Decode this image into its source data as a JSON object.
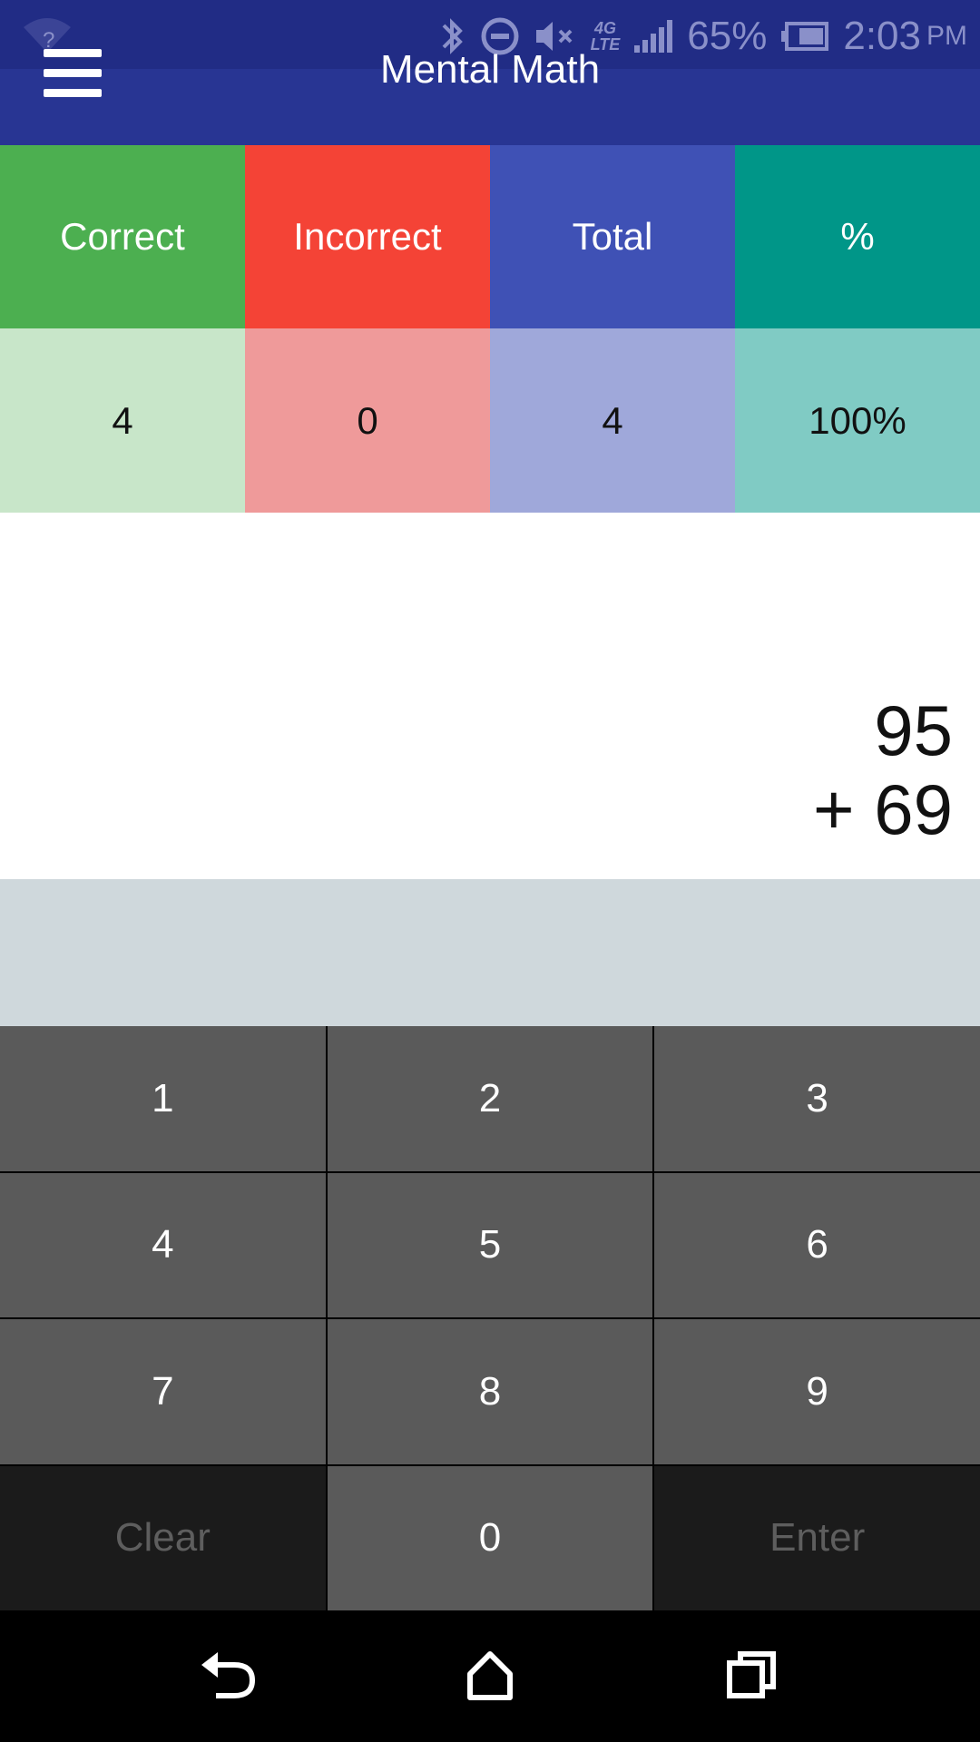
{
  "status_bar": {
    "wifi_indicator": "?",
    "battery_percent": "65%",
    "time": "2:03",
    "ampm": "PM",
    "network": "4G",
    "network_sub": "LTE",
    "icons": [
      "wifi-unknown-icon",
      "bluetooth-icon",
      "do-not-disturb-icon",
      "mute-icon",
      "lte-icon",
      "signal-icon",
      "battery-icon"
    ]
  },
  "app_bar": {
    "title": "Mental Math",
    "menu_icon": "hamburger-menu-icon"
  },
  "score": {
    "headers": [
      "Correct",
      "Incorrect",
      "Total",
      "%"
    ],
    "values": [
      "4",
      "0",
      "4",
      "100%"
    ],
    "header_colors": [
      "#4caf50",
      "#f44336",
      "#3f51b5",
      "#009688"
    ],
    "value_colors": [
      "#c8e6c9",
      "#ef9a9a",
      "#9fa8da",
      "#80cbc4"
    ]
  },
  "question": {
    "operand_top": "95",
    "operator_line": "+ 69"
  },
  "answer": {
    "value": ""
  },
  "keypad": {
    "keys": [
      "1",
      "2",
      "3",
      "4",
      "5",
      "6",
      "7",
      "8",
      "9",
      "Clear",
      "0",
      "Enter"
    ]
  },
  "nav_bar": {
    "icons": [
      "back-icon",
      "home-icon",
      "recents-icon"
    ]
  }
}
